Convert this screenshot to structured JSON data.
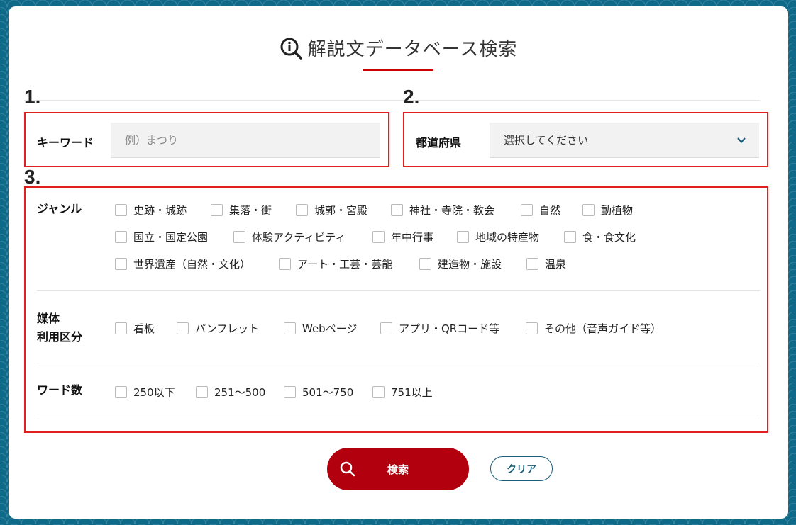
{
  "title": "解説文データベース検索",
  "steps": {
    "one": "1.",
    "two": "2.",
    "three": "3."
  },
  "keyword": {
    "label": "キーワード",
    "placeholder": "例）まつり",
    "value": ""
  },
  "prefecture": {
    "label": "都道府県",
    "selected": "選択してください"
  },
  "genre": {
    "label": "ジャンル",
    "options": [
      "史跡・城跡",
      "集落・街",
      "城郭・宮殿",
      "神社・寺院・教会",
      "自然",
      "動植物",
      "国立・国定公園",
      "体験アクティビティ",
      "年中行事",
      "地域の特産物",
      "食・食文化",
      "世界遺産（自然・文化）",
      "アート・工芸・芸能",
      "建造物・施設",
      "温泉"
    ]
  },
  "media": {
    "label_line1": "媒体",
    "label_line2": "利用区分",
    "options": [
      "看板",
      "パンフレット",
      "Webページ",
      "アプリ・QRコード等",
      "その他（音声ガイド等）"
    ]
  },
  "wordcount": {
    "label": "ワード数",
    "options": [
      "250以下",
      "251〜500",
      "501〜750",
      "751以上"
    ]
  },
  "buttons": {
    "search": "検索",
    "clear": "クリア"
  },
  "colors": {
    "accent_red": "#b3000e",
    "border_red": "#e01f1f",
    "teal": "#1a5f7a",
    "background": "#0f6a8a"
  }
}
